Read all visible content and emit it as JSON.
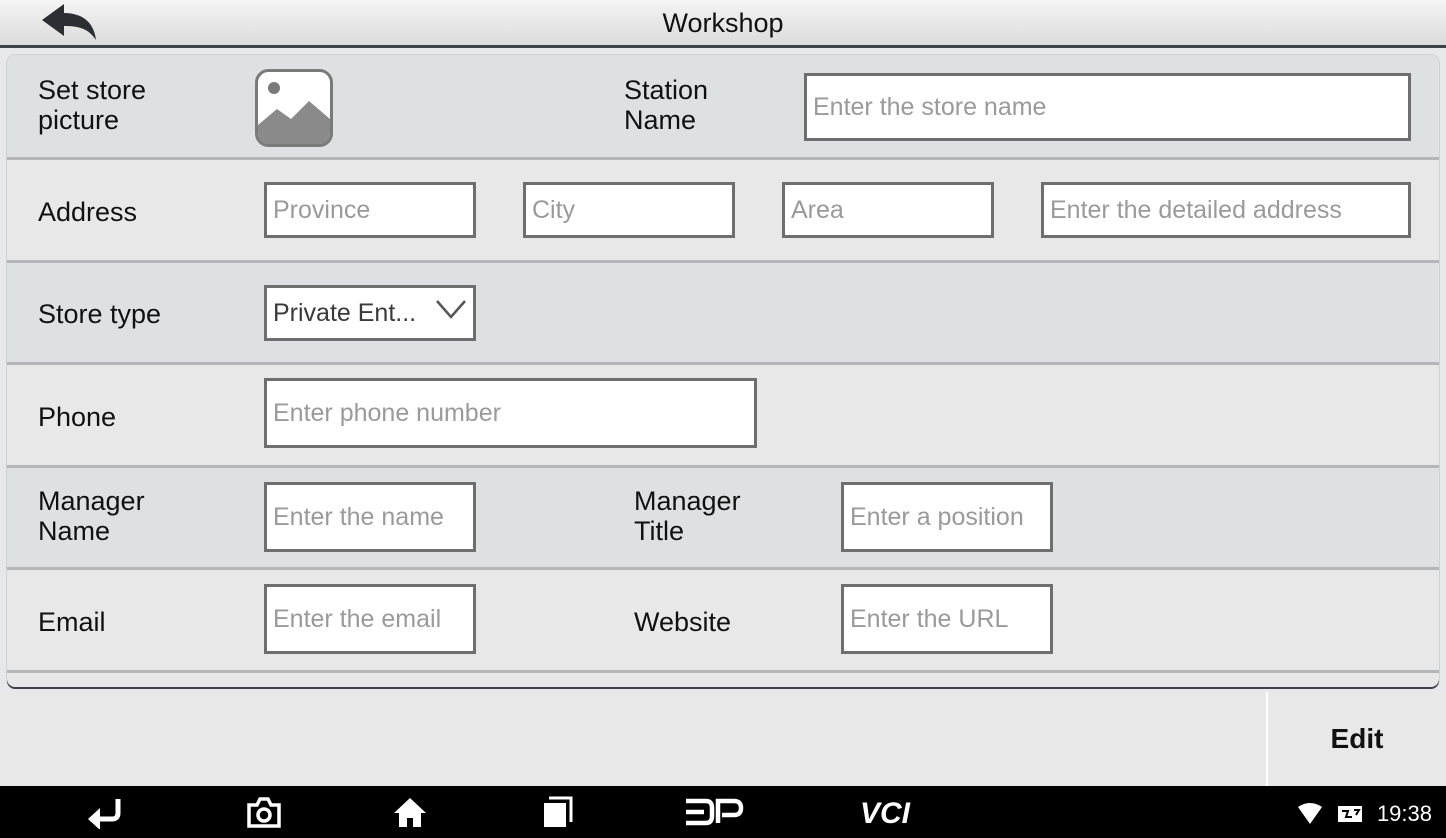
{
  "window": {
    "title": "Workshop"
  },
  "form": {
    "store_picture_label": "Set store\npicture",
    "station_name_label": "Station\nName",
    "station_name_placeholder": "Enter the store name",
    "address_label": "Address",
    "province_placeholder": "Province",
    "city_placeholder": "City",
    "area_placeholder": "Area",
    "detailed_address_placeholder": "Enter the detailed address",
    "store_type_label": "Store type",
    "store_type_value": "Private Ent...",
    "phone_label": "Phone",
    "phone_placeholder": "Enter phone number",
    "manager_name_label": "Manager\nName",
    "manager_name_placeholder": "Enter the name",
    "manager_title_label": "Manager\nTitle",
    "manager_title_placeholder": "Enter a position",
    "email_label": "Email",
    "email_placeholder": "Enter the email",
    "website_label": "Website",
    "website_placeholder": "Enter the URL"
  },
  "actions": {
    "edit_label": "Edit"
  },
  "navbar": {
    "items": [
      "back-icon",
      "camera-icon",
      "home-icon",
      "recents-icon",
      "dp-icon",
      "vci-icon"
    ],
    "dp_text": "DP",
    "vci_text": "VCI"
  },
  "status": {
    "time": "19:38",
    "icons": [
      "wifi-icon",
      "vci-status-icon"
    ]
  }
}
